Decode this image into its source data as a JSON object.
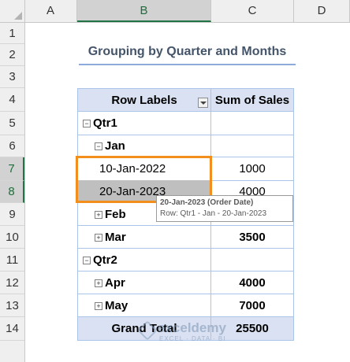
{
  "sheet": {
    "columns": [
      "A",
      "B",
      "C",
      "D"
    ],
    "rows": [
      "1",
      "2",
      "3",
      "4",
      "5",
      "6",
      "7",
      "8",
      "9",
      "10",
      "11",
      "12",
      "13",
      "14"
    ],
    "active_column": "B",
    "active_rows": [
      "7",
      "8"
    ]
  },
  "title": "Grouping by Quarter and Months",
  "pivot": {
    "header_labels": "Row Labels",
    "header_sum": "Sum of Sales",
    "rows": [
      {
        "label": "Qtr1",
        "value": "",
        "level": 0,
        "expander": "−"
      },
      {
        "label": "Jan",
        "value": "",
        "level": 1,
        "expander": "−"
      },
      {
        "label": "10-Jan-2022",
        "value": "1000",
        "level": 2,
        "expander": ""
      },
      {
        "label": "20-Jan-2023",
        "value": "4000",
        "level": 2,
        "expander": ""
      },
      {
        "label": "Feb",
        "value": "",
        "level": 1,
        "expander": "+"
      },
      {
        "label": "Mar",
        "value": "3500",
        "level": 1,
        "expander": "+"
      },
      {
        "label": "Qtr2",
        "value": "",
        "level": 0,
        "expander": "−"
      },
      {
        "label": "Apr",
        "value": "4000",
        "level": 1,
        "expander": "+"
      },
      {
        "label": "May",
        "value": "7000",
        "level": 1,
        "expander": "+"
      }
    ],
    "grand_total_label": "Grand Total",
    "grand_total_value": "25500"
  },
  "tooltip": {
    "line1": "20-Jan-2023 (Order Date)",
    "line2": "Row: Qtr1 - Jan - 20-Jan-2023"
  },
  "watermark": {
    "name": "exceldemy",
    "tagline": "EXCEL · DATA · BI"
  },
  "colors": {
    "accent_orange": "#f28e1b",
    "header_fill": "#d9e1f2",
    "selection_fill": "#bfbfbf",
    "title_text": "#44546a"
  }
}
